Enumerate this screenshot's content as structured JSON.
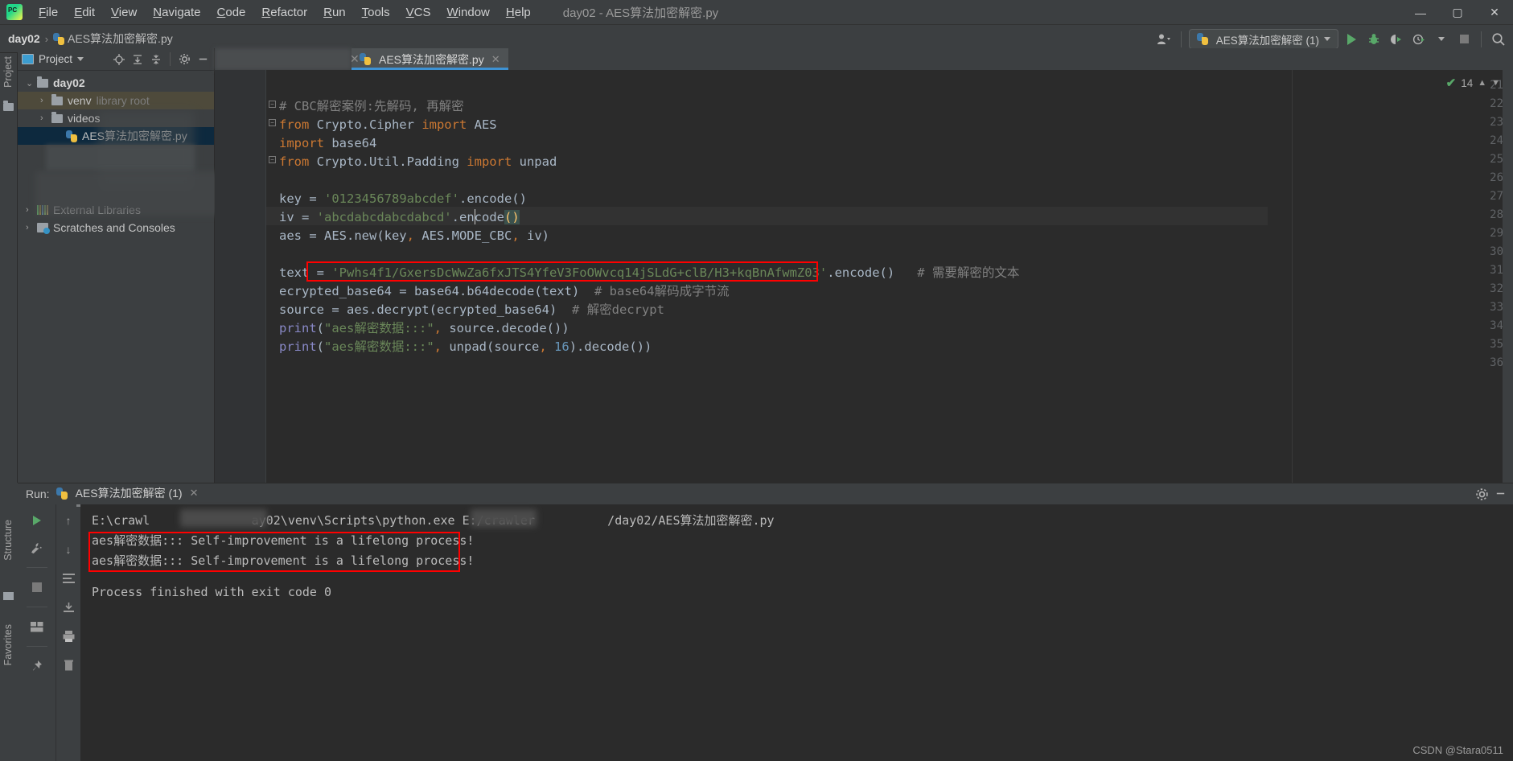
{
  "window": {
    "title": "day02 - AES算法加密解密.py",
    "minimize": "—",
    "maximize": "▢",
    "close": "✕"
  },
  "menubar": {
    "items": [
      "File",
      "Edit",
      "View",
      "Navigate",
      "Code",
      "Refactor",
      "Run",
      "Tools",
      "VCS",
      "Window",
      "Help"
    ]
  },
  "navbar": {
    "breadcrumb": [
      "day02",
      "AES算法加密解密.py"
    ],
    "separator": "›"
  },
  "toolbar": {
    "run_config_label": "AES算法加密解密 (1)",
    "buttons": [
      "run",
      "debug",
      "coverage",
      "profile",
      "stop",
      "search"
    ]
  },
  "project_panel": {
    "title": "Project",
    "tree": [
      {
        "label": "day02",
        "dim": "",
        "depth": 0,
        "arrow": "⌄",
        "icon": "folder",
        "state": "normal"
      },
      {
        "label": "venv",
        "dim": "library root",
        "depth": 1,
        "arrow": "›",
        "icon": "folder",
        "state": "olive"
      },
      {
        "label": "videos",
        "dim": "",
        "depth": 1,
        "arrow": "›",
        "icon": "folder",
        "state": "normal"
      },
      {
        "label": "AES算法加密解密.py",
        "dim": "",
        "depth": 2,
        "arrow": "",
        "icon": "python",
        "state": "blue"
      },
      {
        "label": "External Libraries",
        "dim": "",
        "depth": 0,
        "arrow": "›",
        "icon": "libraries",
        "state": "normal"
      },
      {
        "label": "Scratches and Consoles",
        "dim": "",
        "depth": 0,
        "arrow": "›",
        "icon": "scratches",
        "state": "normal"
      }
    ]
  },
  "left_strip": {
    "project_label": "Project",
    "structure_label": "Structure",
    "favorites_label": "Favorites"
  },
  "tabs": [
    {
      "label": "",
      "blurred": true,
      "active": false
    },
    {
      "label": "AES算法加密解密.py",
      "blurred": false,
      "active": true
    }
  ],
  "editor": {
    "inspection_count": "14",
    "first_line_number": 21,
    "lines": [
      {
        "n": 21,
        "tokens": []
      },
      {
        "n": 22,
        "fold": "minus",
        "tokens": [
          {
            "t": "# CBC解密案例:先解码, 再解密",
            "c": "cmt"
          }
        ]
      },
      {
        "n": 23,
        "fold": "minus",
        "tokens": [
          {
            "t": "from",
            "c": "kw"
          },
          {
            "t": " Crypto.Cipher ",
            "c": "txt"
          },
          {
            "t": "import",
            "c": "kw"
          },
          {
            "t": " AES",
            "c": "txt"
          }
        ]
      },
      {
        "n": 24,
        "tokens": [
          {
            "t": "import",
            "c": "kw"
          },
          {
            "t": " base64",
            "c": "txt"
          }
        ]
      },
      {
        "n": 25,
        "fold": "minus",
        "tokens": [
          {
            "t": "from",
            "c": "kw"
          },
          {
            "t": " Crypto.Util.Padding ",
            "c": "txt"
          },
          {
            "t": "import",
            "c": "kw"
          },
          {
            "t": " unpad",
            "c": "txt"
          }
        ]
      },
      {
        "n": 26,
        "tokens": []
      },
      {
        "n": 27,
        "tokens": [
          {
            "t": "key = ",
            "c": "txt"
          },
          {
            "t": "'0123456789abcdef'",
            "c": "str"
          },
          {
            "t": ".encode()",
            "c": "txt"
          }
        ]
      },
      {
        "n": 28,
        "tokens": [
          {
            "t": "iv = ",
            "c": "txt"
          },
          {
            "t": "'abcdabcdabcdabcd'",
            "c": "str"
          },
          {
            "t": ".encode",
            "c": "txt"
          },
          {
            "t": "()",
            "c": "paren-hl"
          }
        ]
      },
      {
        "n": 29,
        "tokens": [
          {
            "t": "aes = AES.new(key",
            "c": "txt"
          },
          {
            "t": ",",
            "c": "kw"
          },
          {
            "t": " AES.MODE_CBC",
            "c": "txt"
          },
          {
            "t": ",",
            "c": "kw"
          },
          {
            "t": " iv)",
            "c": "txt"
          }
        ]
      },
      {
        "n": 30,
        "tokens": []
      },
      {
        "n": 31,
        "tokens": [
          {
            "t": "text = ",
            "c": "txt"
          },
          {
            "t": "'Pwhs4f1/GxersDcWwZa6fxJTS4YfeV3FoOWvcq14jSLdG+clB/H3+kqBnAfwmZ03'",
            "c": "str"
          },
          {
            "t": ".encode()",
            "c": "txt"
          },
          {
            "t": "   # 需要解密的文本",
            "c": "cmt"
          }
        ]
      },
      {
        "n": 32,
        "tokens": [
          {
            "t": "ecrypted_base64 = base64.b64decode(text)",
            "c": "txt"
          },
          {
            "t": "  # base64解码成字节流",
            "c": "cmt"
          }
        ]
      },
      {
        "n": 33,
        "tokens": [
          {
            "t": "source = aes.decrypt(ecrypted_base64)",
            "c": "txt"
          },
          {
            "t": "  # 解密decrypt",
            "c": "cmt"
          }
        ]
      },
      {
        "n": 34,
        "tokens": [
          {
            "t": "print",
            "c": "pf"
          },
          {
            "t": "(",
            "c": "txt"
          },
          {
            "t": "\"aes解密数据:::\"",
            "c": "str"
          },
          {
            "t": ",",
            "c": "kw"
          },
          {
            "t": " source.decode())",
            "c": "txt"
          }
        ]
      },
      {
        "n": 35,
        "tokens": [
          {
            "t": "print",
            "c": "pf"
          },
          {
            "t": "(",
            "c": "txt"
          },
          {
            "t": "\"aes解密数据:::\"",
            "c": "str"
          },
          {
            "t": ",",
            "c": "kw"
          },
          {
            "t": " unpad(source",
            "c": "txt"
          },
          {
            "t": ",",
            "c": "kw"
          },
          {
            "t": " ",
            "c": "txt"
          },
          {
            "t": "16",
            "c": "num"
          },
          {
            "t": ").decode())",
            "c": "txt"
          }
        ]
      },
      {
        "n": 36,
        "tokens": []
      }
    ],
    "highlighted_line": 31
  },
  "run_panel": {
    "label": "Run:",
    "tab_label": "AES算法加密解密 (1)",
    "close": "✕",
    "console": [
      "E:\\crawl              ay02\\venv\\Scripts\\python.exe E:/crawler          /day02/AES算法加密解密.py",
      "aes解密数据::: Self-improvement is a lifelong process!",
      "aes解密数据::: Self-improvement is a lifelong process!",
      "",
      "Process finished with exit code 0"
    ],
    "highlighted_lines": [
      1,
      2
    ]
  },
  "watermark": "CSDN @Stara0511",
  "colors": {
    "accent_blue": "#3d92d4",
    "run_green": "#59a869",
    "highlight_red": "#ff0000",
    "string_green": "#6a8759",
    "keyword_orange": "#cc7832"
  }
}
